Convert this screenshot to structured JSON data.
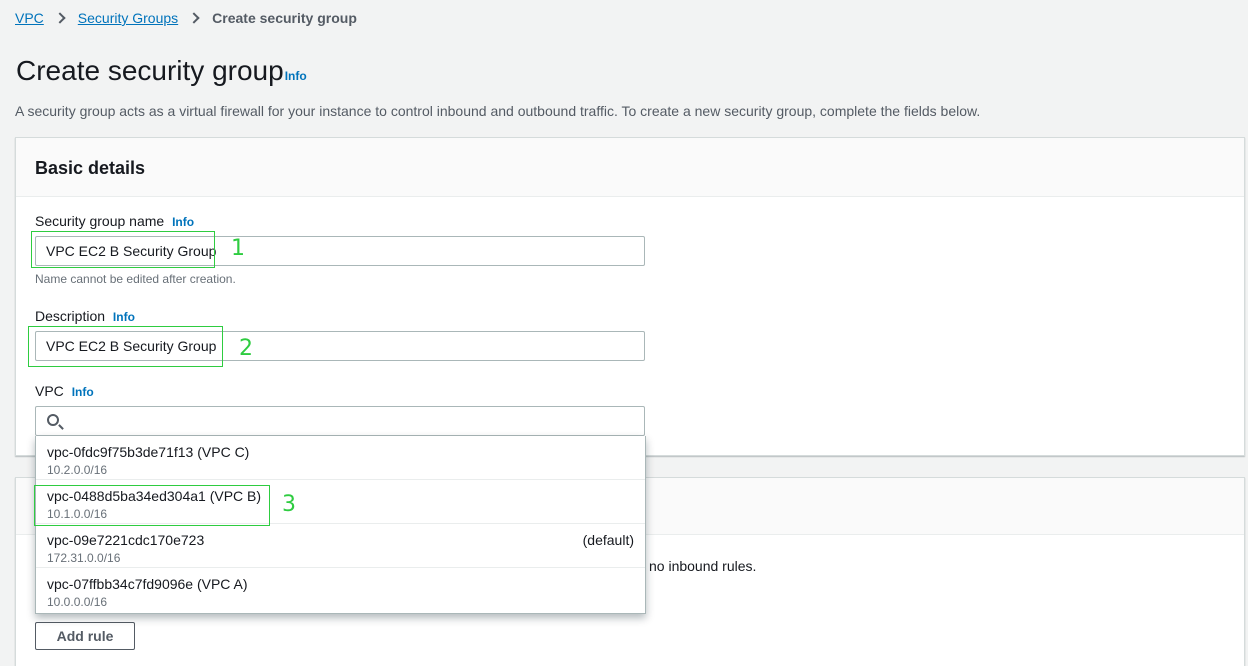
{
  "breadcrumb": {
    "item1": "VPC",
    "item2": "Security Groups",
    "current": "Create security group"
  },
  "page": {
    "title": "Create security group",
    "info": "Info",
    "description": "A security group acts as a virtual firewall for your instance to control inbound and outbound traffic. To create a new security group, complete the fields below."
  },
  "basic_details": {
    "heading": "Basic details",
    "name_label": "Security group name",
    "name_value": "VPC EC2 B Security Group",
    "name_hint": "Name cannot be edited after creation.",
    "desc_label": "Description",
    "desc_value": "VPC EC2 B Security Group",
    "vpc_label": "VPC",
    "info": "Info"
  },
  "vpc_options": [
    {
      "label": "vpc-0fdc9f75b3de71f13 (VPC C)",
      "cidr": "10.2.0.0/16",
      "tag": ""
    },
    {
      "label": "vpc-0488d5ba34ed304a1 (VPC B)",
      "cidr": "10.1.0.0/16",
      "tag": ""
    },
    {
      "label": "vpc-09e7221cdc170e723",
      "cidr": "172.31.0.0/16",
      "tag": "(default)"
    },
    {
      "label": "vpc-07ffbb34c7fd9096e (VPC A)",
      "cidr": "10.0.0.0/16",
      "tag": ""
    }
  ],
  "inbound": {
    "text": "no inbound rules.",
    "add_rule": "Add rule"
  },
  "annotations": [
    "1",
    "2",
    "3"
  ],
  "colors": {
    "link": "#0073bb",
    "annotation": "#2ecc40"
  }
}
